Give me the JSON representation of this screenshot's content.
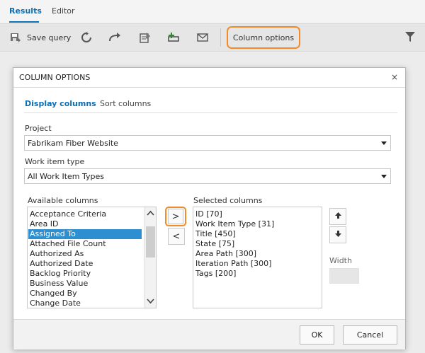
{
  "tabs": [
    {
      "label": "Results",
      "active": true
    },
    {
      "label": "Editor",
      "active": false
    }
  ],
  "toolbar": {
    "save_query_label": "Save query",
    "column_options_label": "Column options",
    "icons": [
      "save-icon",
      "refresh-icon",
      "redo-icon",
      "edit-query-icon",
      "new-work-item-icon",
      "email-icon",
      "filter-icon"
    ]
  },
  "dialog": {
    "title": "COLUMN OPTIONS",
    "close_glyph": "×",
    "subtabs": [
      {
        "label": "Display columns",
        "active": true
      },
      {
        "label": "Sort columns",
        "active": false
      }
    ],
    "project_label": "Project",
    "project_value": "Fabrikam Fiber Website",
    "work_item_type_label": "Work item type",
    "work_item_type_value": "All Work Item Types",
    "available_label": "Available columns",
    "available_columns": [
      "Acceptance Criteria",
      "Area ID",
      "Assigned To",
      "Attached File Count",
      "Authorized As",
      "Authorized Date",
      "Backlog Priority",
      "Business Value",
      "Changed By",
      "Change Date"
    ],
    "available_selected_index": 2,
    "selected_label": "Selected columns",
    "selected_columns": [
      "ID [70]",
      "Work Item Type [31]",
      "Title [450]",
      "State [75]",
      "Area Path [300]",
      "Iteration Path [300]",
      "Tags [200]"
    ],
    "move_right_glyph": ">",
    "move_left_glyph": "<",
    "width_label": "Width",
    "width_value": "",
    "ok_label": "OK",
    "cancel_label": "Cancel"
  },
  "colors": {
    "accent": "#0a6fb4",
    "highlight_outline": "#f28c28",
    "selection": "#2d8fd1"
  }
}
